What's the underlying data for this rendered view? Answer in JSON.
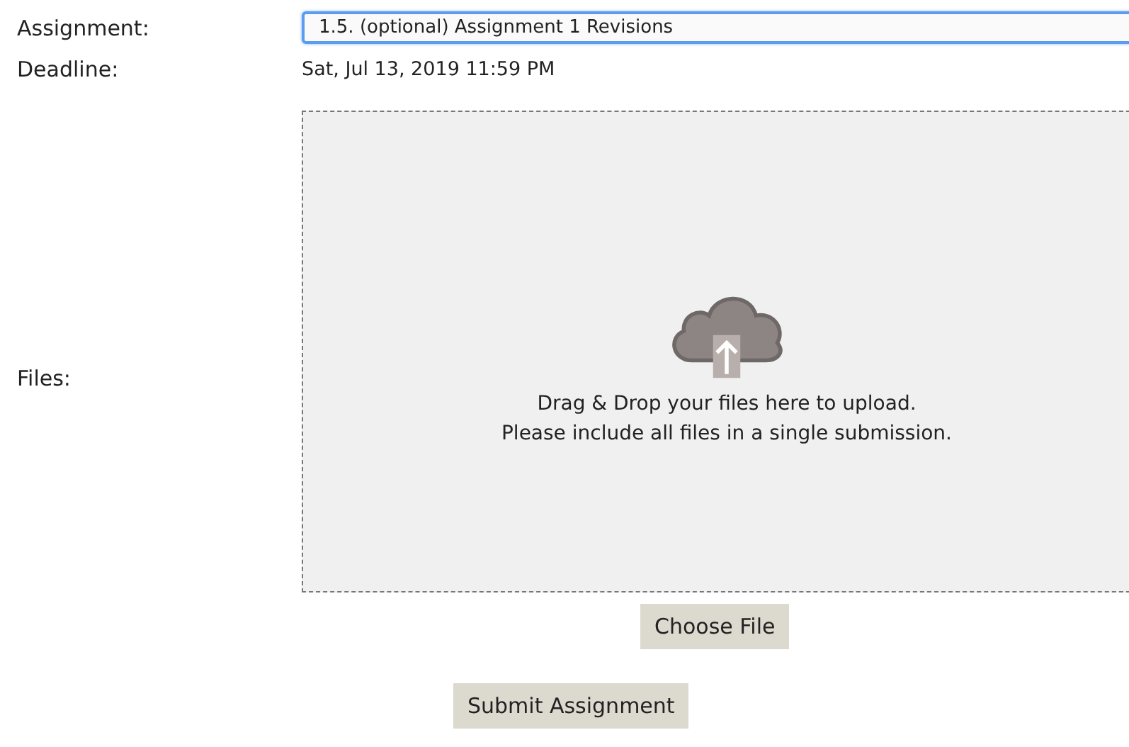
{
  "assignment": {
    "label": "Assignment:",
    "value": "1.5. (optional) Assignment 1 Revisions"
  },
  "deadline": {
    "label": "Deadline:",
    "value": "Sat, Jul 13, 2019 11:59 PM"
  },
  "files": {
    "label": "Files:",
    "dropzone_lines": [
      "Drag & Drop your files here to upload.",
      "Please include all files in a single submission."
    ],
    "choose_button": "Choose File"
  },
  "submit_button": "Submit Assignment"
}
